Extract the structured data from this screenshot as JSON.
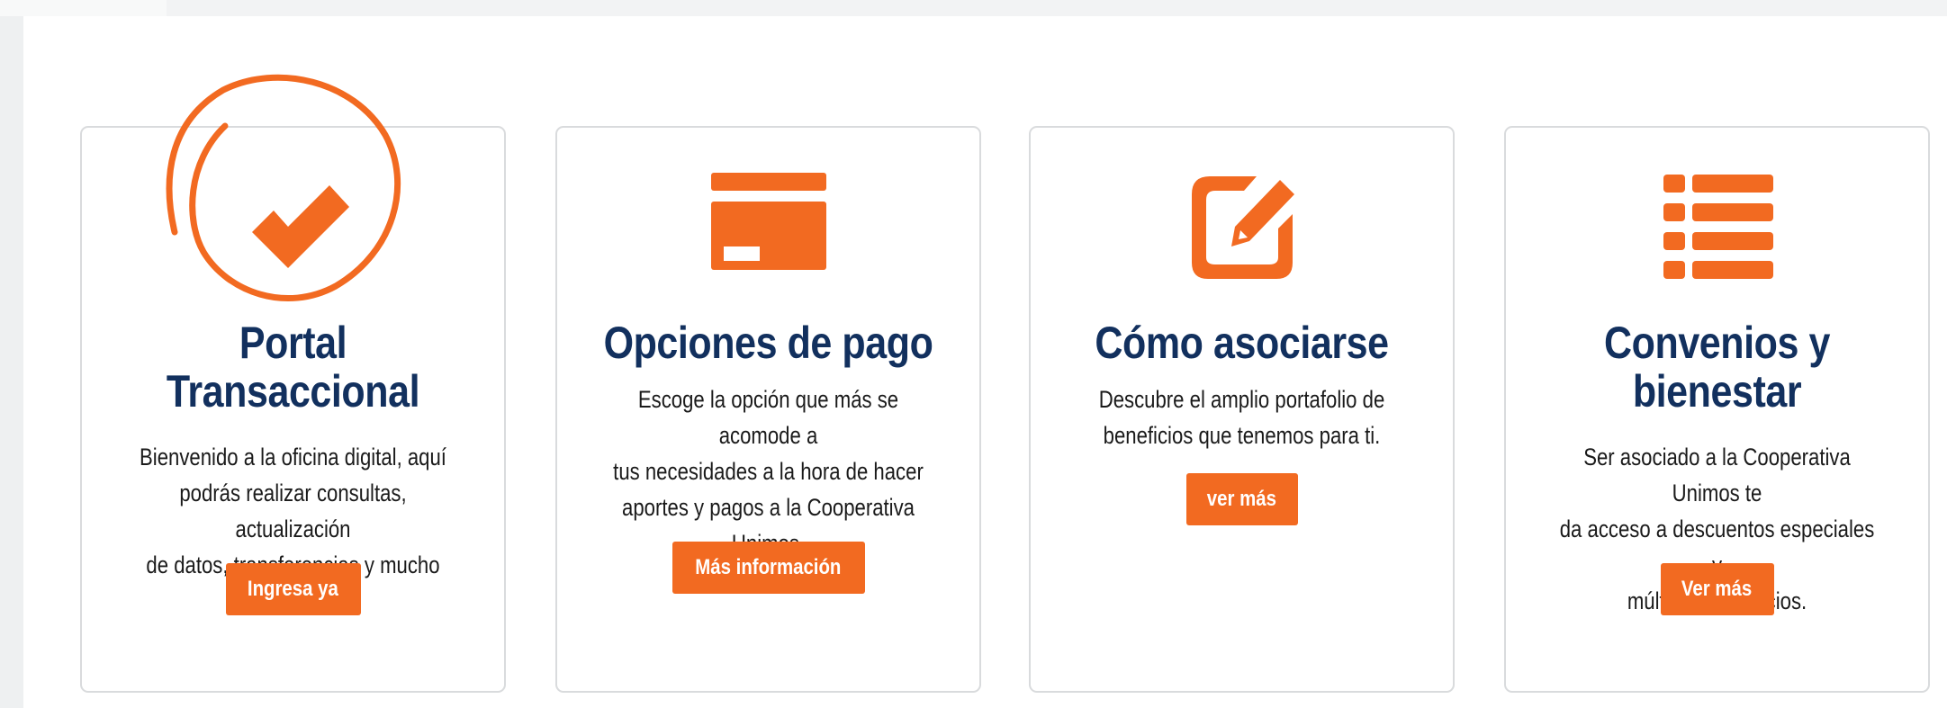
{
  "colors": {
    "accent": "#f26a21",
    "heading": "#12305e",
    "card_border": "#d9dbdd"
  },
  "cards": [
    {
      "icon": "checkmark-icon",
      "title": "Portal Transaccional",
      "title_line1": "Portal",
      "title_line2": "Transaccional",
      "description_lines": [
        "Bienvenido a la oficina digital, aquí",
        "podrás realizar consultas, actualización",
        "de datos, transferencias y mucho más."
      ],
      "button": "Ingresa ya"
    },
    {
      "icon": "credit-card-icon",
      "title": "Opciones de pago",
      "description_lines": [
        "Escoge la opción que más se acomode a",
        "tus necesidades a la hora de hacer",
        "aportes y pagos a la Cooperativa",
        "Unimos."
      ],
      "button": "Más información"
    },
    {
      "icon": "edit-icon",
      "title": "Cómo asociarse",
      "description_lines": [
        "Descubre el amplio portafolio de",
        "beneficios que tenemos para ti."
      ],
      "button": "ver más"
    },
    {
      "icon": "list-icon",
      "title": "Convenios y bienestar",
      "title_line1": "Convenios y",
      "title_line2": "bienestar",
      "description_lines": [
        "Ser asociado a la Cooperativa Unimos te",
        "da acceso a descuentos especiales y",
        "múltiples beneficios."
      ],
      "button": "Ver más"
    }
  ]
}
